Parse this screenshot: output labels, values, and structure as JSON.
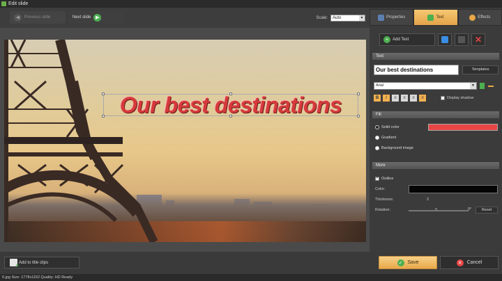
{
  "window": {
    "title": "Edit slide"
  },
  "toolbar": {
    "prev_label": "Previous slide",
    "next_label": "Next slide",
    "scale_label": "Scale:",
    "scale_value": "Auto"
  },
  "canvas": {
    "headline": "Our best destinations"
  },
  "tabs": [
    {
      "label": "Properties"
    },
    {
      "label": "Text"
    },
    {
      "label": "Effects"
    }
  ],
  "panel": {
    "add_text_label": "Add Text",
    "text_section": "Text",
    "text_value": "Our best destinations",
    "templates_label": "Templates",
    "font_value": "Arial",
    "bold": "B",
    "italic": "I",
    "display_shadow": "Display shadow",
    "fill_section": "Fill",
    "solid_color": "Solid color",
    "gradient": "Gradient",
    "background_image": "Background image",
    "more_section": "More",
    "outline": "Outline",
    "color_label": "Color:",
    "thickness_label": "Thickness:",
    "thickness_value": "2",
    "rotation_label": "Rotation:",
    "rotation_value": "0",
    "rotation_max": "0°",
    "reset_label": "Reset"
  },
  "bottom": {
    "add_clips_label": "Add to title clips",
    "save_label": "Save",
    "cancel_label": "Cancel"
  },
  "status": {
    "text": "0.jpg   Size: 1778x1162   Quality: HD Ready"
  },
  "colors": {
    "accent": "#e8a848",
    "fill_color": "#e84545",
    "outline_color": "#050505",
    "headline_color": "#d63a3a"
  },
  "icons": [
    "app-icon",
    "arrow-left-icon",
    "arrow-right-icon",
    "properties-icon",
    "text-icon",
    "effects-icon",
    "add-icon",
    "copy-icon",
    "layer-icon",
    "delete-icon",
    "check-icon",
    "cancel-icon"
  ]
}
